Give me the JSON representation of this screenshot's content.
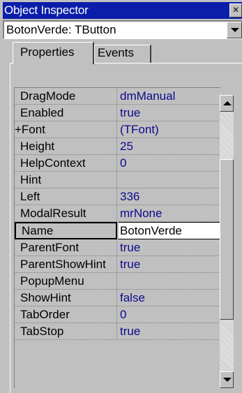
{
  "window": {
    "title": "Object Inspector",
    "close_label": "×"
  },
  "component_selector": {
    "value": "BotonVerde: TButton"
  },
  "tabs": [
    {
      "label": "Properties",
      "active": true
    },
    {
      "label": "Events",
      "active": false
    }
  ],
  "properties": [
    {
      "name": "DragMode",
      "value": "dmManual"
    },
    {
      "name": "Enabled",
      "value": "true"
    },
    {
      "name": "+Font",
      "value": "(TFont)"
    },
    {
      "name": "Height",
      "value": "25"
    },
    {
      "name": "HelpContext",
      "value": "0"
    },
    {
      "name": "Hint",
      "value": ""
    },
    {
      "name": "Left",
      "value": "336"
    },
    {
      "name": "ModalResult",
      "value": "mrNone"
    },
    {
      "name": "Name",
      "value": "BotonVerde",
      "selected": true
    },
    {
      "name": "ParentFont",
      "value": "true"
    },
    {
      "name": "ParentShowHint",
      "value": "true"
    },
    {
      "name": "PopupMenu",
      "value": ""
    },
    {
      "name": "ShowHint",
      "value": "false"
    },
    {
      "name": "TabOrder",
      "value": "0"
    },
    {
      "name": "TabStop",
      "value": "true"
    }
  ],
  "colors": {
    "titlebar": "#0a1eaa",
    "value_text": "#0d0a8c",
    "face": "#c0c0c0"
  }
}
